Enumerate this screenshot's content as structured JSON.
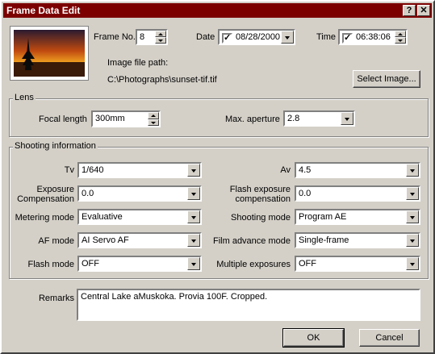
{
  "window": {
    "title": "Frame Data Edit",
    "help_label": "?",
    "close_label": "✕"
  },
  "top": {
    "frame_no_label": "Frame No.",
    "frame_no_value": "8",
    "date_label": "Date",
    "date_value": "08/28/2000",
    "date_checked": "✓",
    "time_label": "Time",
    "time_value": "06:38:06",
    "time_checked": "✓",
    "image_path_label": "Image file path:",
    "image_path_value": "C:\\Photographs\\sunset-tif.tif",
    "select_image_label": "Select Image..."
  },
  "lens": {
    "group_label": "Lens",
    "focal_length_label": "Focal length",
    "focal_length_value": "300mm",
    "max_aperture_label": "Max. aperture",
    "max_aperture_value": "2.8"
  },
  "shooting": {
    "group_label": "Shooting information",
    "tv_label": "Tv",
    "tv_value": "1/640",
    "av_label": "Av",
    "av_value": "4.5",
    "exposure_comp_label_1": "Exposure",
    "exposure_comp_label_2": "Compensation",
    "exposure_comp_value": "0.0",
    "flash_exp_comp_label_1": "Flash exposure",
    "flash_exp_comp_label_2": "compensation",
    "flash_exp_comp_value": "0.0",
    "metering_label": "Metering mode",
    "metering_value": "Evaluative",
    "shooting_mode_label": "Shooting mode",
    "shooting_mode_value": "Program AE",
    "af_mode_label": "AF mode",
    "af_mode_value": "AI Servo AF",
    "film_advance_label": "Film advance mode",
    "film_advance_value": "Single-frame",
    "flash_mode_label": "Flash mode",
    "flash_mode_value": "OFF",
    "multiple_exp_label": "Multiple exposures",
    "multiple_exp_value": "OFF"
  },
  "remarks": {
    "label": "Remarks",
    "value": "Central Lake aMuskoka. Provia 100F. Cropped."
  },
  "buttons": {
    "ok_label": "OK",
    "cancel_label": "Cancel"
  },
  "colors": {
    "titlebar": "#7c0000",
    "face": "#d4d0c8"
  }
}
